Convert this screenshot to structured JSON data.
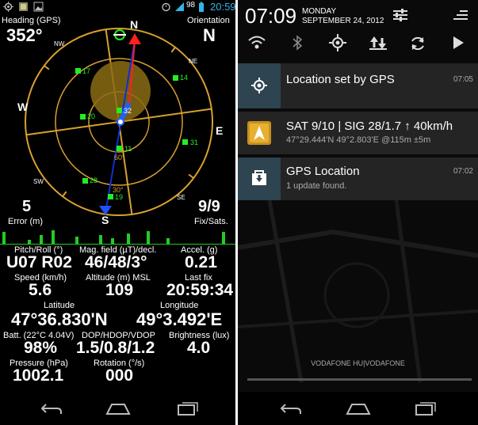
{
  "left": {
    "statusbar": {
      "battery": "98",
      "time": "20:59"
    },
    "heading": {
      "label": "Heading (GPS)",
      "value": "352°"
    },
    "orientation": {
      "label": "Orientation",
      "value": "N"
    },
    "compass": {
      "cardinals": {
        "n": "N",
        "e": "E",
        "s": "S",
        "w": "W"
      },
      "intercardinals": {
        "nw": "NW",
        "ne": "NE",
        "se": "SE",
        "sw": "SW"
      },
      "satellites": [
        "17",
        "14",
        "32",
        "20",
        "31",
        "11",
        "28",
        "19"
      ],
      "elevations": [
        "60°",
        "30°"
      ]
    },
    "error": {
      "value": "5",
      "label": "Error (m)"
    },
    "fix": {
      "value": "9/9",
      "label": "Fix/Sats."
    },
    "readings": {
      "pitch_roll": {
        "label": "Pitch/Roll (°)",
        "value": "U07 R02"
      },
      "mag_field": {
        "label": "Mag. field (µT)/decl.",
        "value": "46/48/3°"
      },
      "accel": {
        "label": "Accel. (g)",
        "value": "0.21"
      },
      "speed": {
        "label": "Speed (km/h)",
        "value": "5.6"
      },
      "altitude": {
        "label": "Altitude (m) MSL",
        "value": "109"
      },
      "last_fix": {
        "label": "Last fix",
        "value": "20:59:34"
      },
      "latitude": {
        "label": "Latitude",
        "value": "47°36.830'N"
      },
      "longitude": {
        "label": "Longitude",
        "value": "49°3.492'E"
      },
      "battery": {
        "label": "Batt. (22°C 4.04V)",
        "value": "98%"
      },
      "dop": {
        "label": "DOP/HDOP/VDOP",
        "value": "1.5/0.8/1.2"
      },
      "brightness": {
        "label": "Brightness (lux)",
        "value": "4.0"
      },
      "pressure": {
        "label": "Pressure (hPa)",
        "value": "1002.1"
      },
      "rotation": {
        "label": "Rotation (°/s)",
        "value": "000"
      }
    }
  },
  "right": {
    "header": {
      "time": "07:09",
      "weekday": "MONDAY",
      "date": "SEPTEMBER 24, 2012"
    },
    "notifications": [
      {
        "title": "Location set by GPS",
        "time": "07:05"
      },
      {
        "title": "SAT 9/10 | SIG 28/1.7 ↑ 40km/h",
        "subtitle": "47°29.444'N 49°2.803'E @115m ±5m"
      },
      {
        "title": "GPS Location",
        "subtitle": "1 update found.",
        "time": "07:02"
      }
    ],
    "carrier": "VODAFONE HU|VODAFONE"
  },
  "colors": {
    "accent": "#33b5e5",
    "compass": "#e0a030",
    "sat": "#22ee22"
  }
}
